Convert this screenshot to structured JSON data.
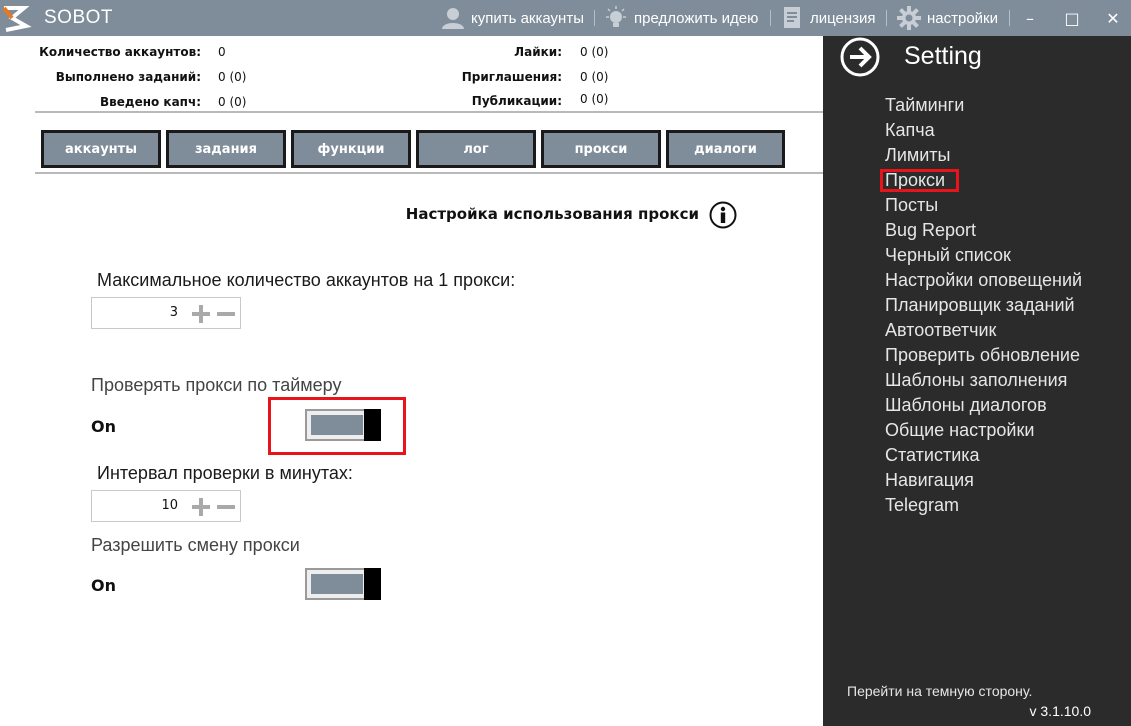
{
  "app": {
    "title": "SOBOT"
  },
  "titlebar": {
    "buy_accounts": "купить аккаунты",
    "suggest_idea": "предложить идею",
    "license": "лицензия",
    "settings": "настройки",
    "icons": [
      "user-icon",
      "lightbulb-icon",
      "document-icon",
      "gear-icon"
    ]
  },
  "window_controls": {
    "minimize": "–",
    "maximize": "□",
    "close": "✕"
  },
  "stats": {
    "accounts_label": "Количество аккаунтов:",
    "accounts_value": "0",
    "tasks_label": "Выполнено заданий:",
    "tasks_value": "0 (0)",
    "captcha_label": "Введено капч:",
    "captcha_value": "0 (0)",
    "likes_label": "Лайки:",
    "likes_value": "0 (0)",
    "invites_label": "Приглашения:",
    "invites_value": "0 (0)",
    "posts_label": "Публикации:",
    "posts_value": "0 (0)"
  },
  "tabs": [
    {
      "label": "аккаунты"
    },
    {
      "label": "задания"
    },
    {
      "label": "функции"
    },
    {
      "label": "лог"
    },
    {
      "label": "прокси"
    },
    {
      "label": "диалоги"
    }
  ],
  "proxy": {
    "title": "Настройка использования прокси",
    "max_accounts_label": "Максимальное количество аккаунтов на 1 прокси:",
    "max_accounts_value": "3",
    "check_timer_label": "Проверять прокси по таймеру",
    "check_timer_state": "On",
    "interval_label": "Интервал проверки в минутах:",
    "interval_value": "10",
    "allow_change_label": "Разрешить смену прокси",
    "allow_change_state": "On"
  },
  "panel": {
    "title": "Setting",
    "items": [
      {
        "label": "Тайминги"
      },
      {
        "label": "Капча"
      },
      {
        "label": "Лимиты"
      },
      {
        "label": "Прокси"
      },
      {
        "label": "Посты"
      },
      {
        "label": "Bug Report"
      },
      {
        "label": "Черный список"
      },
      {
        "label": "Настройки оповещений"
      },
      {
        "label": "Планировщик заданий"
      },
      {
        "label": "Автоответчик"
      },
      {
        "label": "Проверить обновление"
      },
      {
        "label": "Шаблоны заполнения"
      },
      {
        "label": "Шаблоны диалогов"
      },
      {
        "label": "Общие настройки"
      },
      {
        "label": "Статистика"
      },
      {
        "label": "Навигация"
      },
      {
        "label": "Telegram"
      }
    ],
    "dark_side": "Перейти на темную сторону.",
    "version": "v 3.1.10.0"
  },
  "colors": {
    "titlebar": "#7f8c99",
    "panel_bg": "#2b2b2b",
    "highlight": "#e8141b",
    "toggle_knob": "#000000"
  }
}
